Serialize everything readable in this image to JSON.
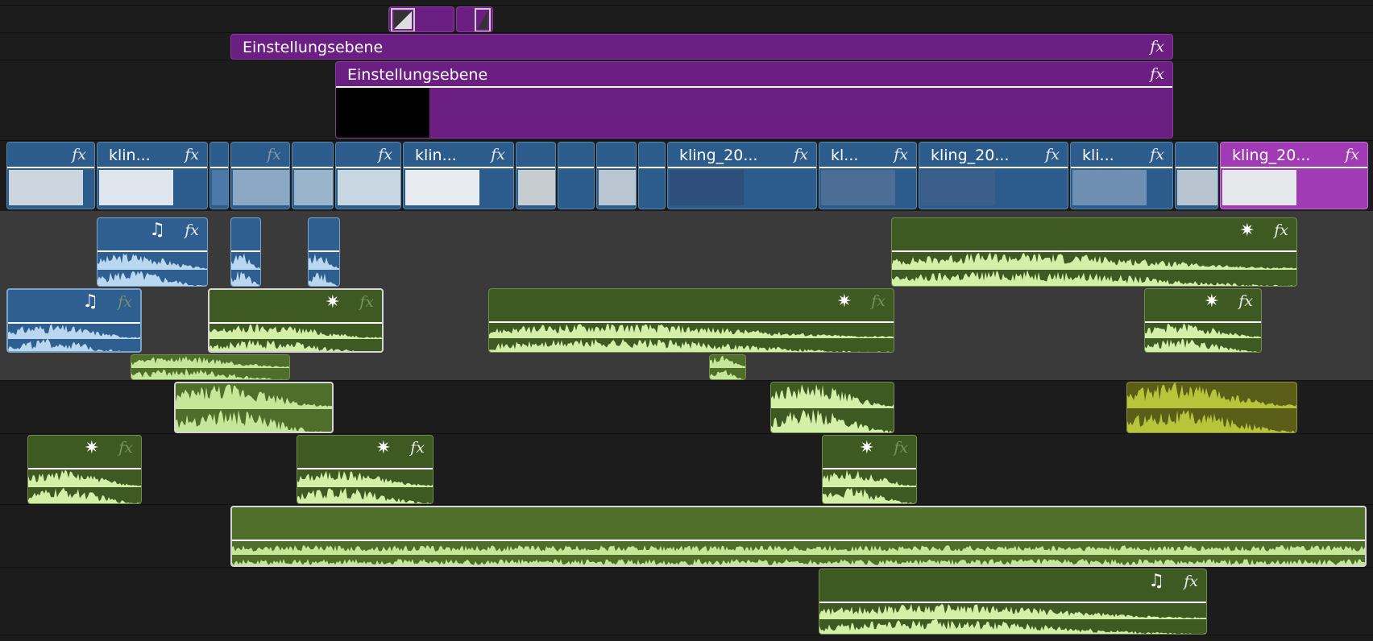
{
  "timeline": {
    "adjustment_layers": [
      {
        "label": "Einstellungsebene",
        "fx": "fx"
      },
      {
        "label": "Einstellungsebene",
        "fx": "fx"
      }
    ],
    "video_clips": [
      {
        "label": "",
        "fx": "fx"
      },
      {
        "label": "klin...",
        "fx": "fx"
      },
      {
        "label": "",
        "fx": "fx"
      },
      {
        "label": "",
        "fx": "fx"
      },
      {
        "label": "klin...",
        "fx": "fx"
      },
      {
        "label": "kling_20...",
        "fx": "fx"
      },
      {
        "label": "kl...",
        "fx": "fx"
      },
      {
        "label": "kling_20...",
        "fx": "fx"
      },
      {
        "label": "kli...",
        "fx": "fx"
      },
      {
        "label": "kling_20...",
        "fx": "fx"
      }
    ],
    "audio_badges": {
      "fx": "fx",
      "star": "✷",
      "note": "♫"
    },
    "colors": {
      "adjustment": "#6c1f83",
      "video": "#2b5c8c",
      "audio": "#3e5a22",
      "waveform": "#d4f0a8",
      "selection": "#d6d6d6"
    }
  }
}
